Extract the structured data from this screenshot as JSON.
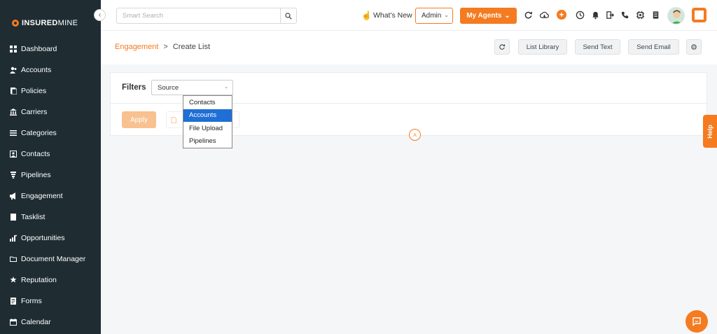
{
  "brand": {
    "name_bold": "INSURED",
    "name_light": "MINE"
  },
  "sidebar": {
    "items": [
      {
        "label": "Dashboard",
        "icon": "dashboard-icon"
      },
      {
        "label": "Accounts",
        "icon": "accounts-icon"
      },
      {
        "label": "Policies",
        "icon": "policies-icon"
      },
      {
        "label": "Carriers",
        "icon": "carriers-icon"
      },
      {
        "label": "Categories",
        "icon": "categories-icon"
      },
      {
        "label": "Contacts",
        "icon": "contacts-icon"
      },
      {
        "label": "Pipelines",
        "icon": "pipelines-icon"
      },
      {
        "label": "Engagement",
        "icon": "engagement-icon"
      },
      {
        "label": "Tasklist",
        "icon": "tasklist-icon"
      },
      {
        "label": "Opportunities",
        "icon": "opportunities-icon"
      },
      {
        "label": "Document Manager",
        "icon": "folder-icon"
      },
      {
        "label": "Reputation",
        "icon": "reputation-icon"
      },
      {
        "label": "Forms",
        "icon": "forms-icon"
      },
      {
        "label": "Calendar",
        "icon": "calendar-icon"
      }
    ]
  },
  "topbar": {
    "search_placeholder": "Smart Search",
    "whats_new": "What's New",
    "admin": "Admin",
    "my_agents": "My Agents"
  },
  "breadcrumb": {
    "parent": "Engagement",
    "separator": ">",
    "current": "Create List"
  },
  "header_buttons": {
    "list_library": "List Library",
    "send_text": "Send Text",
    "send_email": "Send Email"
  },
  "filters": {
    "label": "Filters",
    "source_value": "Source",
    "options": [
      "Contacts",
      "Accounts",
      "File Upload",
      "Pipelines"
    ],
    "selected_index": 1,
    "apply": "Apply"
  },
  "help": "Help",
  "colors": {
    "accent": "#f47b20",
    "sidebar_bg": "#1f2d33",
    "selected": "#1f6fd6"
  }
}
